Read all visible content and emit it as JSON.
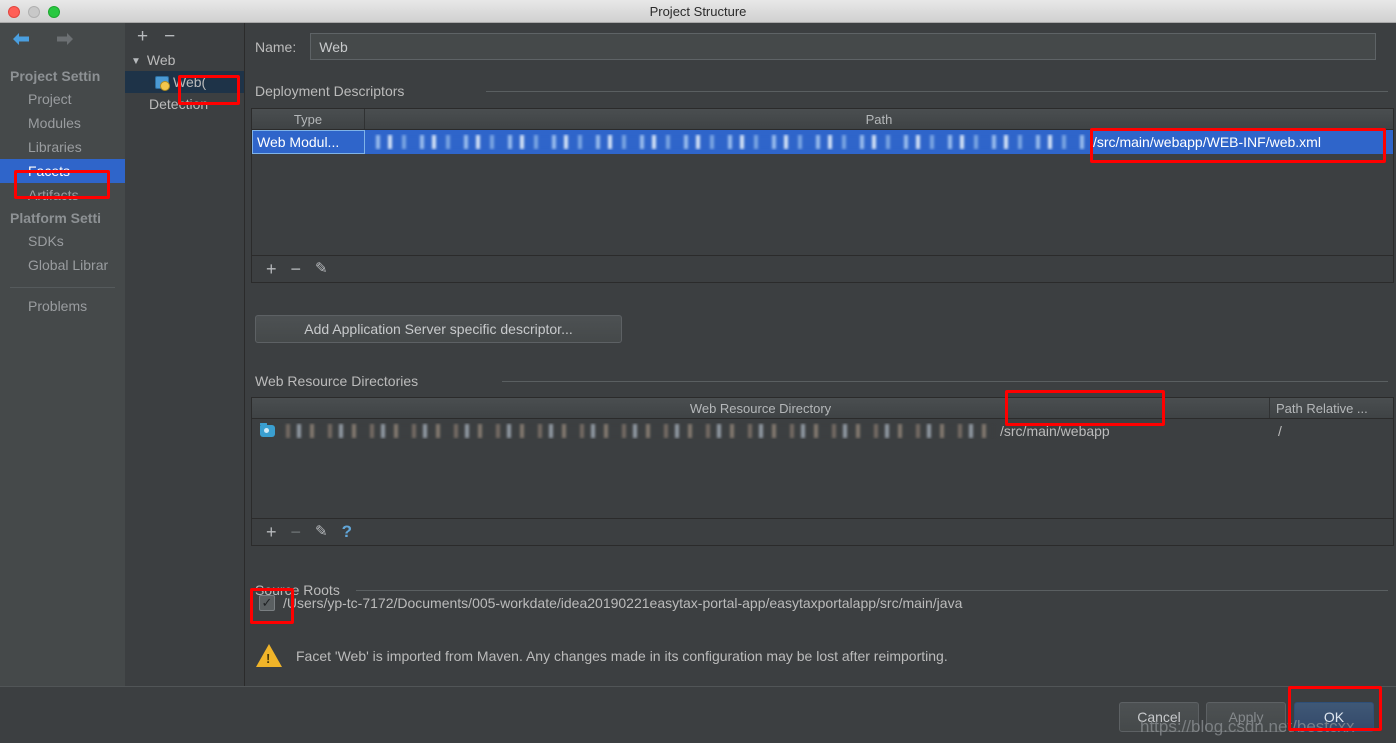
{
  "window": {
    "title": "Project Structure",
    "traffic_lights": [
      "close-red",
      "minimize-grey",
      "maximize-green"
    ]
  },
  "sidebar": {
    "back_icon": "back-arrow-icon",
    "forward_icon": "forward-arrow-icon",
    "groups": [
      {
        "label": "Project Settin",
        "items": [
          {
            "label": "Project",
            "selected": false
          },
          {
            "label": "Modules",
            "selected": false
          },
          {
            "label": "Libraries",
            "selected": false
          },
          {
            "label": "Facets",
            "selected": true
          },
          {
            "label": "Artifacts",
            "selected": false
          }
        ]
      },
      {
        "label": "Platform Setti",
        "items": [
          {
            "label": "SDKs",
            "selected": false
          },
          {
            "label": "Global Librar",
            "selected": false
          }
        ]
      }
    ],
    "problems_label": "Problems",
    "help_icon": "question-mark-icon"
  },
  "tree": {
    "add_label": "+",
    "remove_label": "−",
    "root_label": "Web",
    "child_label": "Web",
    "child_suffix": "(",
    "leaf_label": "Detection"
  },
  "main": {
    "name_label": "Name:",
    "name_value": "Web",
    "deployment": {
      "section_title": "Deployment Descriptors",
      "columns": [
        "Type",
        "Path"
      ],
      "row": {
        "type": "Web Modul...",
        "path_visible_tail": "/src/main/webapp/WEB-INF/web.xml",
        "path_redacted": true
      },
      "toolbar": [
        "add-icon",
        "remove-icon",
        "edit-pencil-icon"
      ],
      "add_descriptor_button": "Add Application Server specific descriptor..."
    },
    "web_resources": {
      "section_title": "Web Resource Directories",
      "columns": [
        "Web Resource Directory",
        "Path Relative ..."
      ],
      "row": {
        "directory_visible_tail": "/src/main/webapp",
        "directory_redacted": true,
        "path_relative": "/"
      },
      "toolbar": [
        "add-icon",
        "remove-icon",
        "edit-pencil-icon",
        "help-icon"
      ]
    },
    "source_roots": {
      "section_title": "Source Roots",
      "checkbox_checked": true,
      "path": "/Users/yp-tc-7172/Documents/005-workdate/idea20190221easytax-portal-app/easytaxportalapp/src/main/java"
    },
    "warning": {
      "icon": "warning-triangle-icon",
      "text": "Facet 'Web' is imported from Maven. Any changes made in its configuration may be lost after reimporting."
    }
  },
  "footer": {
    "buttons": [
      {
        "label": "Cancel",
        "style": "normal"
      },
      {
        "label": "Apply",
        "style": "disabled"
      },
      {
        "label": "OK",
        "style": "primary"
      }
    ],
    "watermark": "https://blog.csdn.net/bestcxx"
  },
  "colors": {
    "background": "#3c3f41",
    "sidebar": "#45494a",
    "selection_blue": "#2f65ca",
    "annotation_red": "#ff0000",
    "accent_link": "#62a6d8",
    "warning_yellow": "#f0b429"
  },
  "annotations": {
    "highlight_boxes": [
      "facets-sidebar-item",
      "web-facet-tree-node",
      "web-xml-path",
      "webapp-directory-path",
      "source-root-checkbox",
      "ok-button"
    ]
  }
}
